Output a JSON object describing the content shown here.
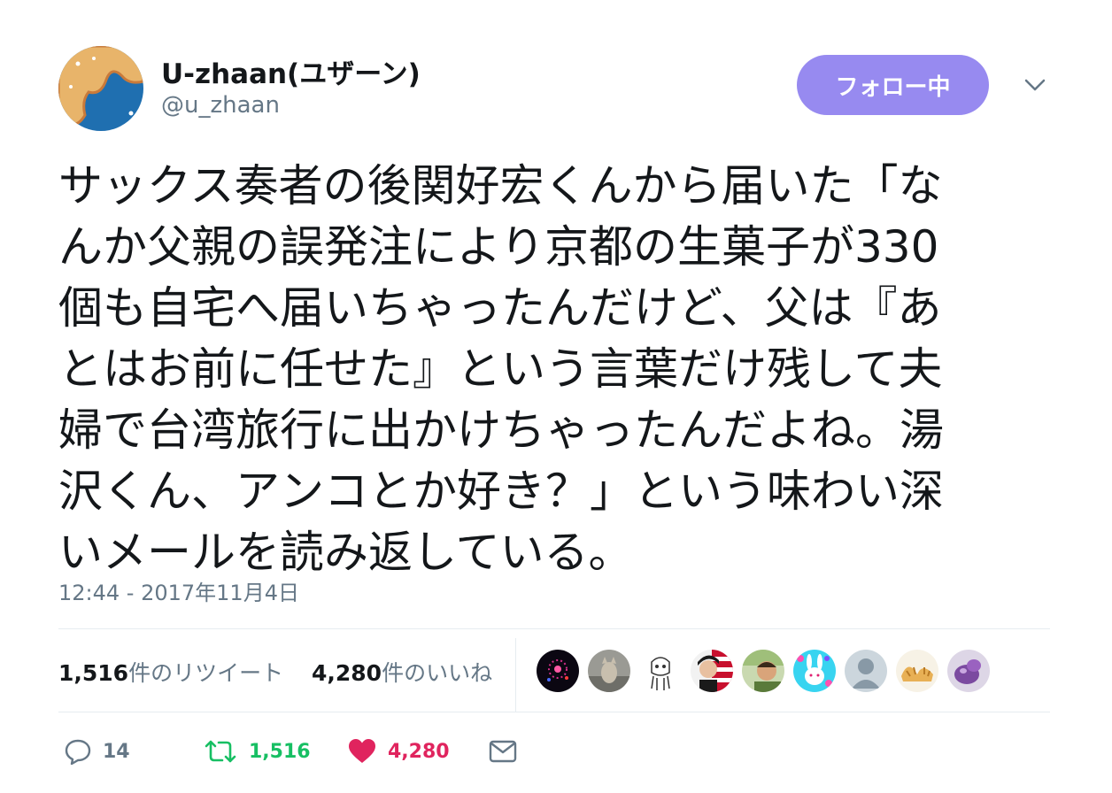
{
  "user": {
    "display_name": "U-zhaan(ユザーン)",
    "handle": "@u_zhaan",
    "follow_label": "フォロー中"
  },
  "tweet": {
    "lines": [
      "サックス奏者の後関好宏くんから届いた「な",
      "んか父親の誤発注により京都の生菓子が330",
      "個も自宅へ届いちゃったんだけど、父は『あ",
      "とはお前に任せた』という言葉だけ残して夫",
      "婦で台湾旅行に出かけちゃったんだよね。湯",
      "沢くん、アンコとか好き？」という味わい深",
      "いメールを読み返している。"
    ],
    "timestamp": "12:44 - 2017年11月4日"
  },
  "stats": {
    "retweets_count": "1,516",
    "retweets_label": "件のリツイート",
    "likes_count": "4,280",
    "likes_label": "件のいいね"
  },
  "actions": {
    "reply_count": "14",
    "retweet_count": "1,516",
    "like_count": "4,280"
  },
  "colors": {
    "follow_button": "#978af0",
    "retweet_green": "#17bf63",
    "like_red": "#e0245e",
    "muted": "#657786"
  },
  "likers": [
    "fireworks-avatar",
    "cat-avatar",
    "sketch-avatar",
    "woman-flag-avatar",
    "man-outdoor-avatar",
    "bunny-avatar",
    "default-avatar",
    "gyoza-avatar",
    "purple-avatar"
  ]
}
